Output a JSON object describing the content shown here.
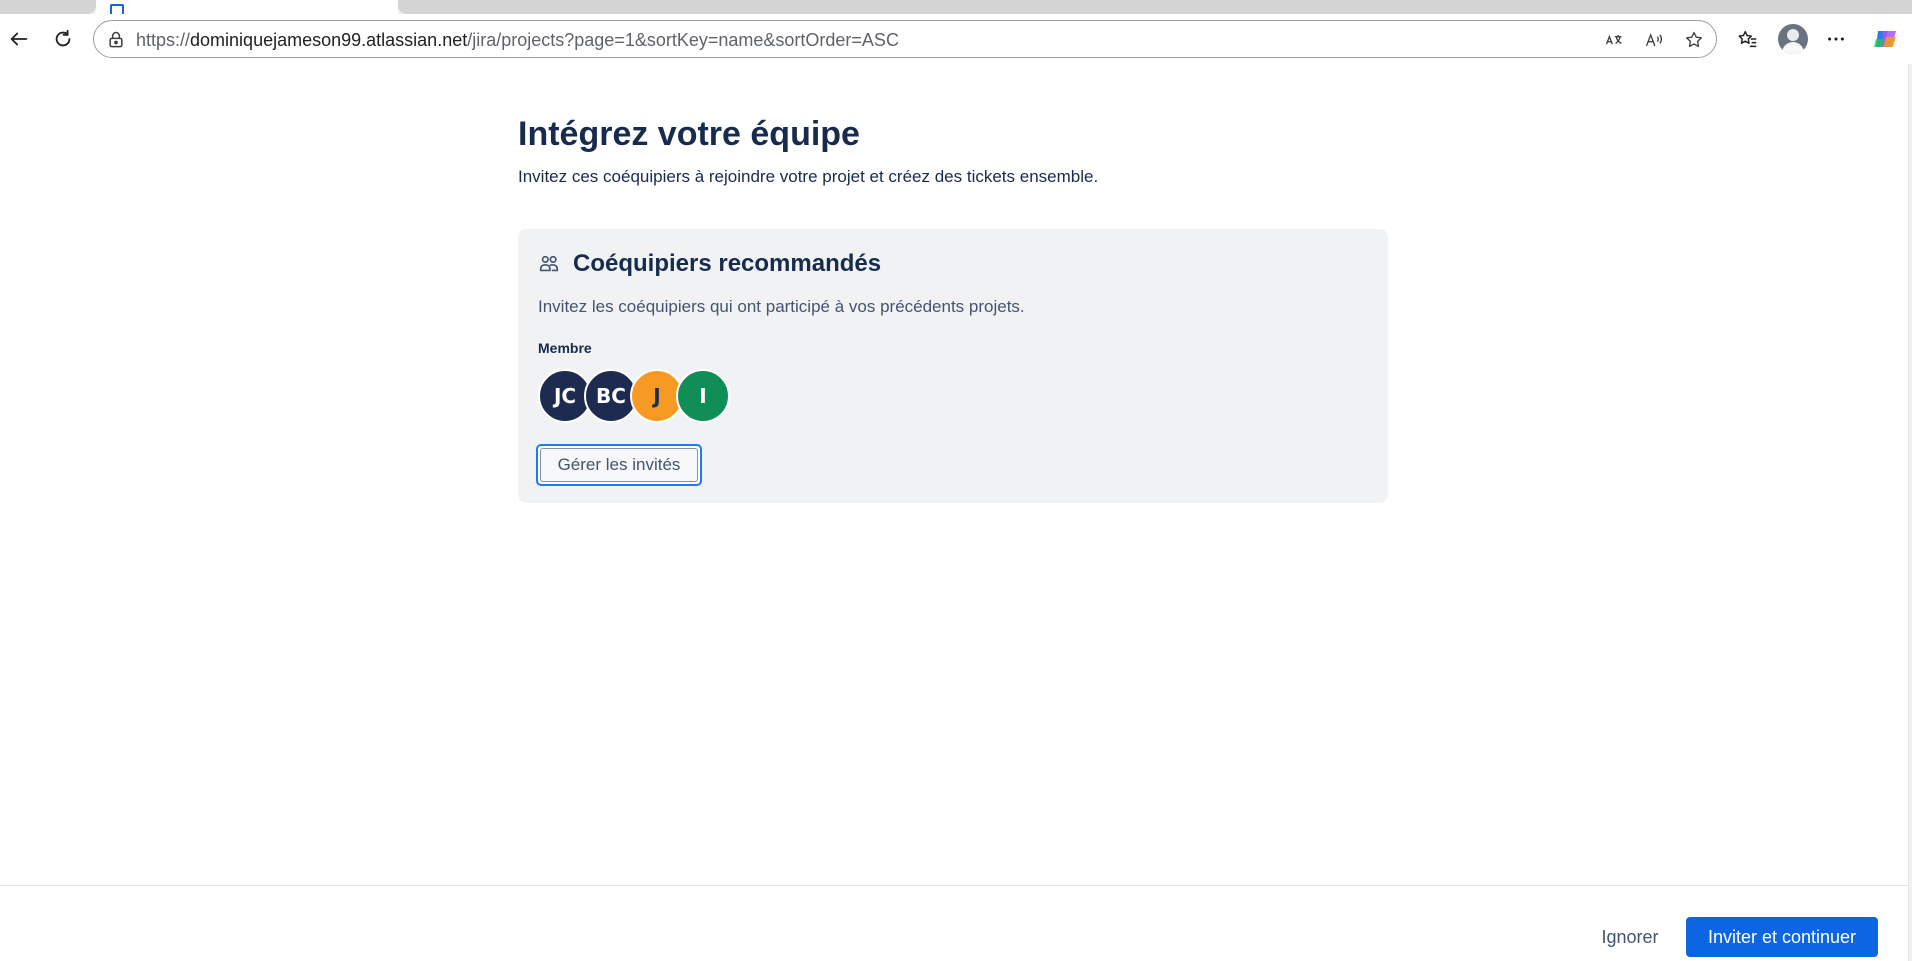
{
  "browser": {
    "url_prefix": "https://",
    "url_host": "dominiquejameson99.atlassian.net",
    "url_path": "/jira/projects?page=1&sortKey=name&sortOrder=ASC",
    "icons": {
      "back": "back-arrow-icon",
      "refresh": "refresh-icon",
      "site_info": "lock-icon",
      "translate": "translate-icon",
      "read_aloud": "read-aloud-icon",
      "favorite": "star-icon",
      "favorites_list": "favorites-icon",
      "profile": "profile-avatar",
      "menu": "more-icon",
      "copilot": "copilot-icon"
    }
  },
  "page": {
    "title": "Intégrez votre équipe",
    "subtitle": "Invitez ces coéquipiers à rejoindre votre projet et créez des tickets ensemble."
  },
  "card": {
    "title": "Coéquipiers recommandés",
    "description": "Invitez les coéquipiers qui ont participé à vos précédents projets.",
    "member_label": "Membre",
    "avatars": [
      {
        "initials": "JC",
        "color": "#1c2b4f"
      },
      {
        "initials": "BC",
        "color": "#1c2b4f"
      },
      {
        "initials": "J",
        "color": "#f79a23"
      },
      {
        "initials": "I",
        "color": "#108e58"
      }
    ],
    "manage_button": "Gérer les invités"
  },
  "footer": {
    "ignore_label": "Ignorer",
    "invite_label": "Inviter et continuer"
  },
  "colors": {
    "primary": "#0c66e4",
    "focus_ring": "#1d7afc",
    "card_bg": "#f1f2f4",
    "text": "#172b4d"
  }
}
